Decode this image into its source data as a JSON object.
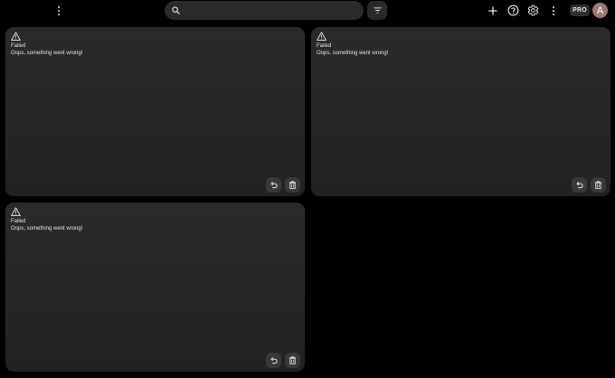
{
  "header": {
    "menu_icon": "more-vert-icon",
    "search": {
      "value": "",
      "placeholder": "",
      "icon": "search-icon"
    },
    "filter_icon": "filter-icon",
    "add_icon": "plus-icon",
    "help_icon": "help-circle-icon",
    "settings_icon": "gear-icon",
    "more_icon": "more-vert-icon",
    "pro_label": "PRO",
    "avatar_initial": "A"
  },
  "cards": [
    {
      "title": "Failed",
      "message": "Oops, something went wrong!",
      "status_icon": "warning-icon",
      "retry_icon": "undo-icon",
      "delete_icon": "trash-icon"
    },
    {
      "title": "Failed",
      "message": "Oops, something went wrong!",
      "status_icon": "warning-icon",
      "retry_icon": "undo-icon",
      "delete_icon": "trash-icon"
    },
    {
      "title": "Failed",
      "message": "Oops, something went wrong!",
      "status_icon": "warning-icon",
      "retry_icon": "undo-icon",
      "delete_icon": "trash-icon"
    }
  ],
  "colors": {
    "background": "#000000",
    "card": "#262626",
    "avatar": "#9e7a70"
  }
}
